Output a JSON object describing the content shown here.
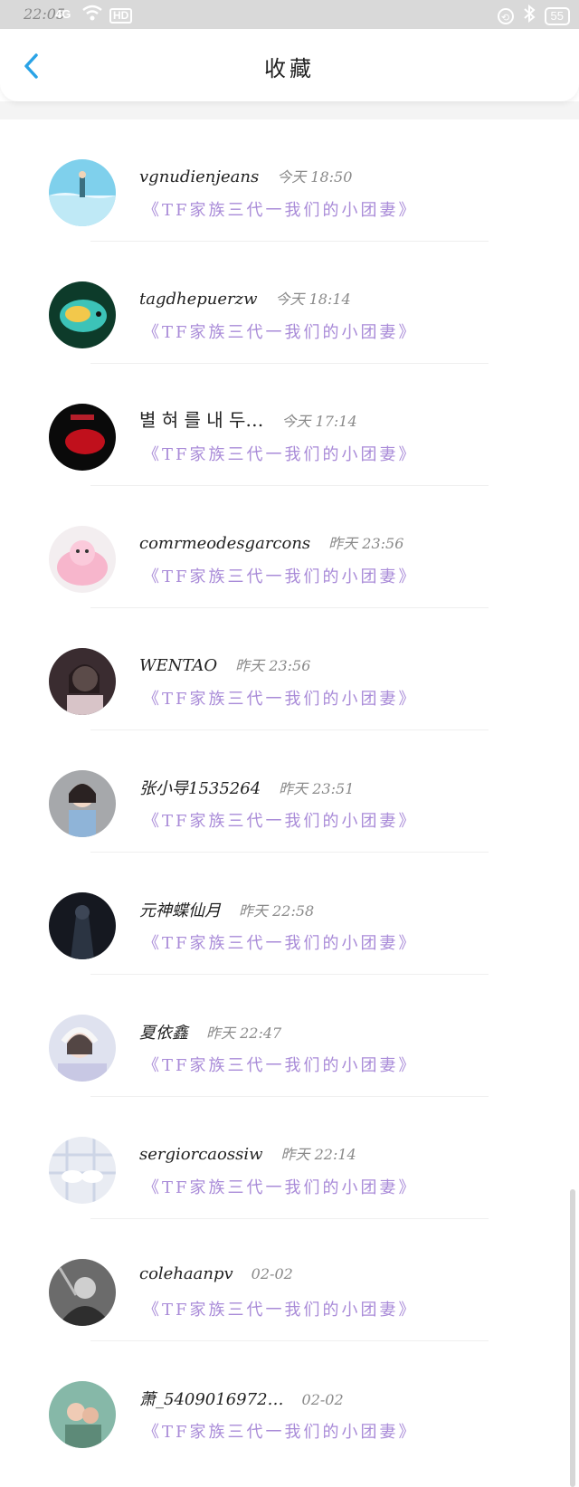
{
  "status_bar": {
    "time": "22:05",
    "signal": "4G",
    "hd": "HD",
    "battery": "55"
  },
  "header": {
    "title": "收藏"
  },
  "favorites": [
    {
      "name": "vgnudienjeans",
      "time": "今天 18:50",
      "subtitle": "《TF家族三代一我们的小团妻》"
    },
    {
      "name": "tagdhepuerzw",
      "time": "今天 18:14",
      "subtitle": "《TF家族三代一我们的小团妻》"
    },
    {
      "name": "별 혀 를 내 두…",
      "time": "今天 17:14",
      "subtitle": "《TF家族三代一我们的小团妻》"
    },
    {
      "name": "comrmeodesgarcons",
      "time": "昨天 23:56",
      "subtitle": "《TF家族三代一我们的小团妻》"
    },
    {
      "name": "WENTAO",
      "time": "昨天 23:56",
      "subtitle": "《TF家族三代一我们的小团妻》"
    },
    {
      "name": "张小导1535264",
      "time": "昨天 23:51",
      "subtitle": "《TF家族三代一我们的小团妻》"
    },
    {
      "name": "元神蝶仙月",
      "time": "昨天 22:58",
      "subtitle": "《TF家族三代一我们的小团妻》"
    },
    {
      "name": "夏依鑫",
      "time": "昨天 22:47",
      "subtitle": "《TF家族三代一我们的小团妻》"
    },
    {
      "name": "sergiorcaossiw",
      "time": "昨天 22:14",
      "subtitle": "《TF家族三代一我们的小团妻》"
    },
    {
      "name": "colehaanpv",
      "time": "02-02",
      "subtitle": "《TF家族三代一我们的小团妻》"
    },
    {
      "name": "萧_5409016972…",
      "time": "02-02",
      "subtitle": "《TF家族三代一我们的小团妻》"
    }
  ],
  "colors": {
    "accent": "#2aa3e6",
    "subtitle": "#a98bd8",
    "status_bar_bg": "#d9d9d9"
  },
  "icons": {
    "back": "chevron-left-icon"
  }
}
